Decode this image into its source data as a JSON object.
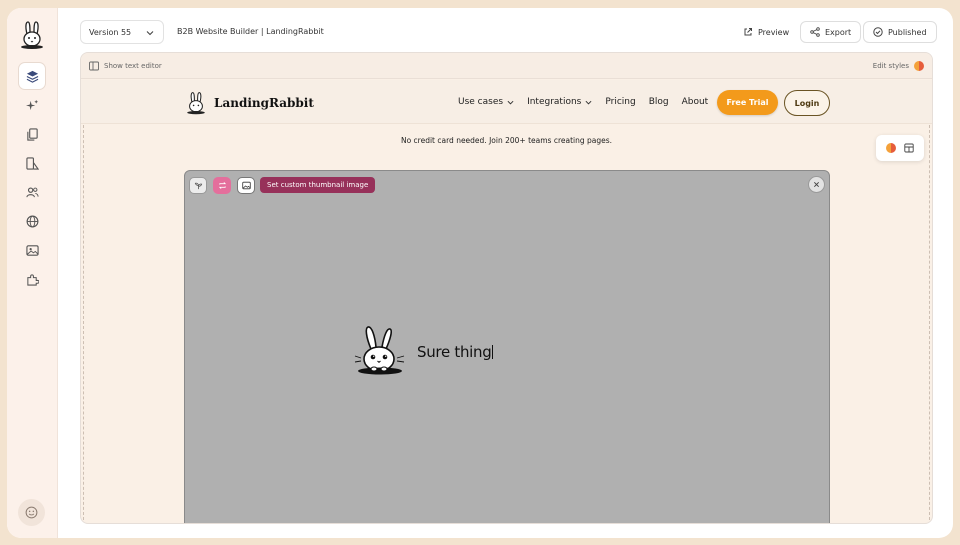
{
  "sidebar": {
    "logo": "rabbit-logo",
    "items": [
      {
        "name": "layers",
        "icon": "layers-icon",
        "active": true
      },
      {
        "name": "ai",
        "icon": "sparkles-icon",
        "active": false
      },
      {
        "name": "pages",
        "icon": "pages-icon",
        "active": false
      },
      {
        "name": "design",
        "icon": "shapes-icon",
        "active": false
      },
      {
        "name": "team",
        "icon": "users-icon",
        "active": false
      },
      {
        "name": "domain",
        "icon": "globe-icon",
        "active": false
      },
      {
        "name": "media",
        "icon": "image-icon",
        "active": false
      },
      {
        "name": "integrations",
        "icon": "puzzle-icon",
        "active": false
      }
    ],
    "bottom_icon": "smile-icon"
  },
  "topbar": {
    "version_label": "Version 55",
    "doc_title": "B2B Website Builder | LandingRabbit",
    "preview_label": "Preview",
    "export_label": "Export",
    "published_label": "Published"
  },
  "canvas": {
    "show_text_editor_label": "Show text editor",
    "edit_styles_label": "Edit styles"
  },
  "site": {
    "brand": "LandingRabbit",
    "nav": [
      {
        "label": "Use cases",
        "dropdown": true
      },
      {
        "label": "Integrations",
        "dropdown": true
      },
      {
        "label": "Pricing",
        "dropdown": false
      },
      {
        "label": "Blog",
        "dropdown": false
      },
      {
        "label": "About",
        "dropdown": false
      }
    ],
    "free_trial_label": "Free Trial",
    "login_label": "Login",
    "note": "No credit card needed. Join 200+ teams creating pages."
  },
  "video": {
    "thumbnail_tag": "Set custom thumbnail image",
    "text": "Sure thing"
  },
  "colors": {
    "accent_orange": "#f39a1b",
    "thumbnail_tag": "#97315a",
    "video_bg": "#b0b0b0"
  }
}
